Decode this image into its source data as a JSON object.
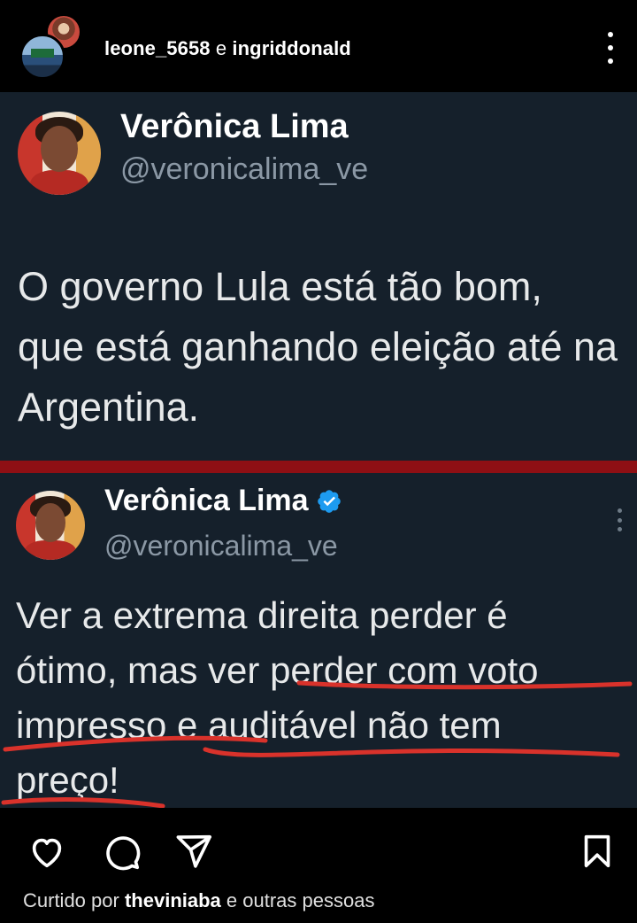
{
  "header": {
    "user1": "leone_5658",
    "conjunction": "e",
    "user2": "ingriddonald"
  },
  "tweet1": {
    "name": "Verônica Lima",
    "handle": "@veronicalima_ve",
    "text": "O governo Lula está tão bom, que está ganhando eleição até na Argentina."
  },
  "tweet2": {
    "name": "Verônica Lima",
    "handle": "@veronicalima_ve",
    "text_line1": "Ver a extrema direita perder é",
    "text_line2": "ótimo, mas ver perder com voto",
    "text_line3": "impresso e auditável não tem",
    "text_line4": "preço!",
    "verified_color": "#1d9bf0",
    "annotation_color": "#d9322b"
  },
  "footer": {
    "liked_prefix": "Curtido por",
    "liked_user": "theviniaba",
    "liked_suffix": "e outras pessoas"
  },
  "icons": [
    "heart-icon",
    "comment-icon",
    "send-icon",
    "bookmark-icon",
    "more-icon",
    "verified-icon"
  ]
}
